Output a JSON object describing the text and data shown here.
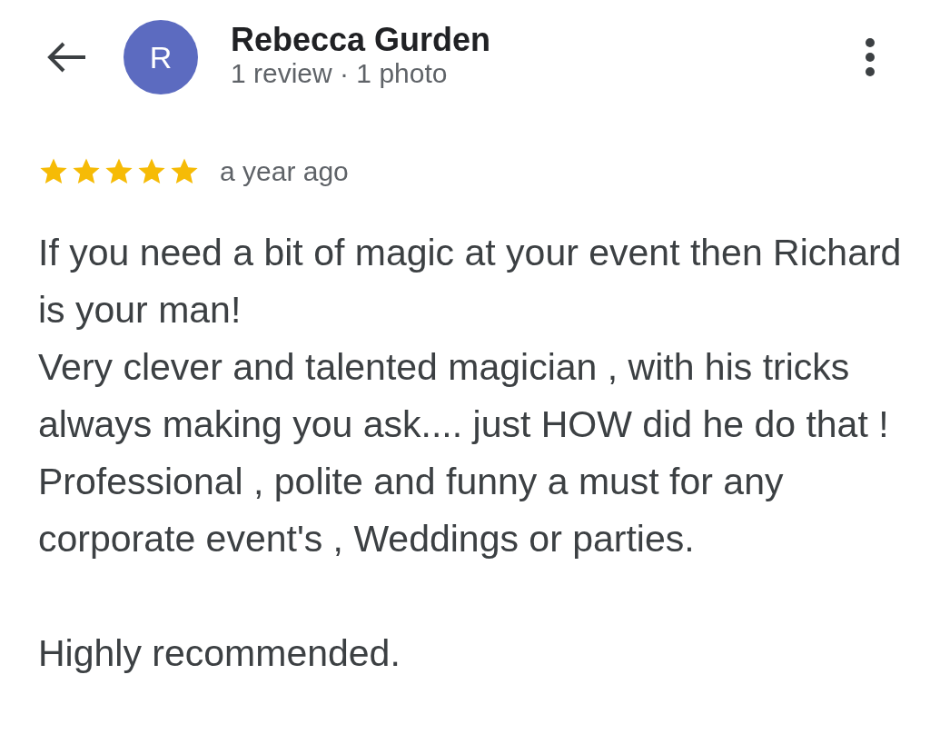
{
  "header": {
    "avatar_letter": "R",
    "name": "Rebecca Gurden",
    "subtitle": "1 review · 1 photo"
  },
  "review": {
    "stars": 5,
    "time": "a year ago",
    "text": "If you need a bit of magic at your event then Richard is your man!\nVery clever and talented magician , with his tricks always making you ask.... just HOW did he do that !\nProfessional , polite and funny a must for any corporate event's , Weddings or parties.\n\nHighly recommended."
  }
}
